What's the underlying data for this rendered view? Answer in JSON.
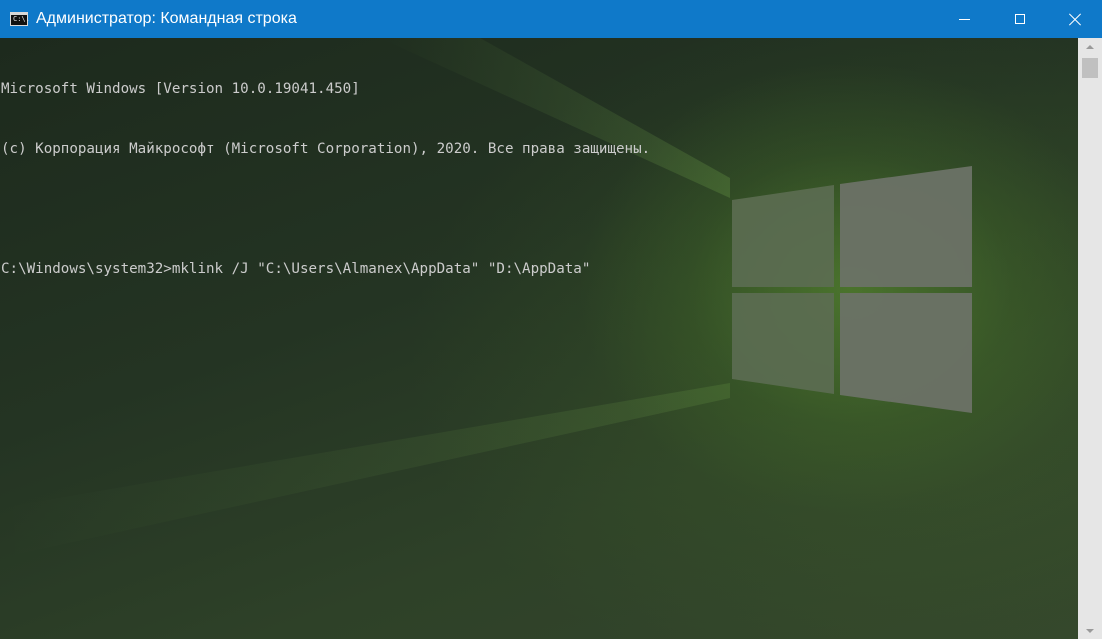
{
  "window": {
    "title": "Администратор: Командная строка",
    "icon_label": "C:\\.",
    "controls": [
      "minimize-icon",
      "maximize-icon",
      "close-icon"
    ],
    "titlebar_color": "#0f79c9"
  },
  "console": {
    "lines": [
      "Microsoft Windows [Version 10.0.19041.450]",
      "(c) Корпорация Майкрософт (Microsoft Corporation), 2020. Все права защищены.",
      "",
      "C:\\Windows\\system32>mklink /J \"C:\\Users\\Almanex\\AppData\" \"D:\\AppData\""
    ],
    "text_color": "#cccccc",
    "background": "windows-10-desktop-wallpaper-green-tint"
  },
  "scrollbar": {
    "arrows": [
      "up",
      "down"
    ]
  }
}
